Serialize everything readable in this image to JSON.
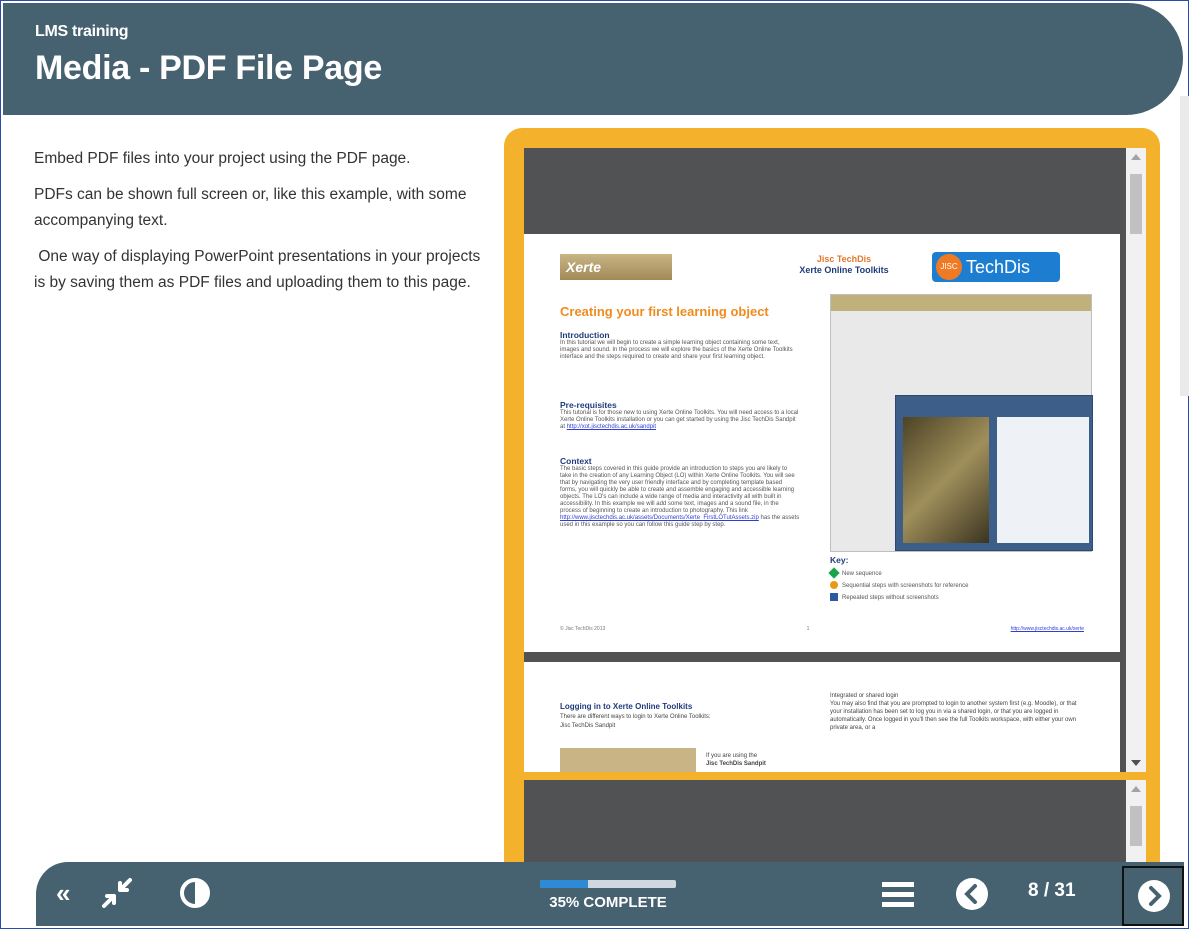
{
  "header": {
    "course": "LMS training",
    "title": "Media - PDF File Page"
  },
  "body": {
    "paragraphs": [
      "Embed PDF files into your project using the PDF page.",
      "PDFs can be shown full screen or, like this example, with some accompanying text.",
      " One way of displaying PowerPoint presentations in your projects is by saving them as PDF files and uploading them to this page."
    ]
  },
  "pdf": {
    "page1": {
      "logo_left": "Xerte",
      "brand_line1": "Jisc TechDis",
      "brand_line2": "Xerte Online Toolkits",
      "logo_right": "TechDis",
      "logo_right_badge": "JISC",
      "heading": "Creating your first learning object",
      "sections": [
        {
          "title": "Introduction",
          "text": "In this tutorial we will begin to create a simple learning object containing some text, images and sound. In the process we will explore the basics of the Xerte Online Toolkits interface and the steps required to create and share your first learning object."
        },
        {
          "title": "Pre-requisites",
          "text": "This tutorial is for those new to using Xerte Online Toolkits. You will need access to a local Xerte Online Toolkits installation or you can get started by using the Jisc TechDis Sandpit at",
          "link": "http://xot.jisctechdis.ac.uk/sandpit"
        },
        {
          "title": "Context",
          "text": "The basic steps covered in this guide provide an introduction to steps you are likely to take in the creation of any Learning Object (LO) within Xerte Online Toolkits. You will see that by navigating the very user friendly interface and by completing template based forms, you will quickly be able to create and assemble engaging and accessible learning objects. The LO's can include a wide range of media and interactivity all with built in accessibility. In this example we will add some text, images and a sound file, in the process of beginning to create an introduction to photography. This link",
          "link": "http://www.jisctechdis.ac.uk/assets/Documents/Xerte_FirstLOTutAssets.zip",
          "text_after": "has the assets used in this example so you can follow this guide step by step."
        }
      ],
      "key_title": "Key:",
      "key_items": [
        {
          "color": "#1aa34a",
          "label": "New sequence"
        },
        {
          "color": "#e79a12",
          "label": "Sequential steps with screenshots for reference"
        },
        {
          "color": "#2c5aa0",
          "label": "Repeated steps without screenshots"
        }
      ],
      "footer_left": "© Jisc TechDis 2013",
      "footer_mid": "1",
      "footer_right": "http://www.jisctechdis.ac.uk/xerte"
    },
    "page2": {
      "title": "Logging in to Xerte Online Toolkits",
      "line1": "There are different ways to login to Xerte Online Toolkits:",
      "line2": "Jisc TechDis Sandpit",
      "line3": "If you are using the",
      "line4": "Jisc TechDis Sandpit",
      "right1": "Integrated or shared login",
      "right2": "You may also find that you are prompted to login to another system first (e.g. Moodle), or that your installation has been set to log you in via a shared login, or that you are logged in automatically. Once logged in you'll then see the full Toolkits workspace, with either your own private area, or a"
    }
  },
  "footer": {
    "progress_value": 0.35,
    "progress_label": "35% COMPLETE",
    "page_count": "8 / 31"
  },
  "icons": {
    "rewind": "rewind-icon",
    "collapse": "collapse-icon",
    "contrast": "contrast-icon",
    "menu": "menu-icon",
    "prev": "chevron-left-icon",
    "next": "chevron-right-icon"
  },
  "colors": {
    "header_bg": "#466170",
    "frame": "#f4b12c",
    "progress_fill": "#2f8ad6"
  }
}
